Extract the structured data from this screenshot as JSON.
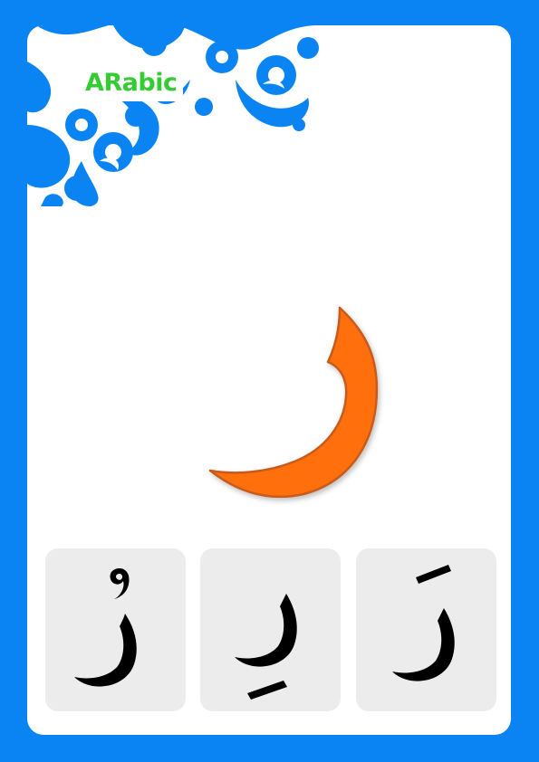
{
  "brand": {
    "label": "ARabic",
    "color": "#33cc33"
  },
  "theme": {
    "frame_color": "#0A84F2",
    "ornament_color": "#0A84F2",
    "card_color": "#ffffff",
    "tile_color": "#ececec",
    "letter_fill": "#FF7010",
    "letter_stroke": "#C85A1A"
  },
  "letter": {
    "icon": "arabic-letter-ra"
  },
  "vowel_tiles": [
    {
      "icon": "ra-with-damma"
    },
    {
      "icon": "ra-with-kasra"
    },
    {
      "icon": "ra-with-fatha"
    }
  ]
}
